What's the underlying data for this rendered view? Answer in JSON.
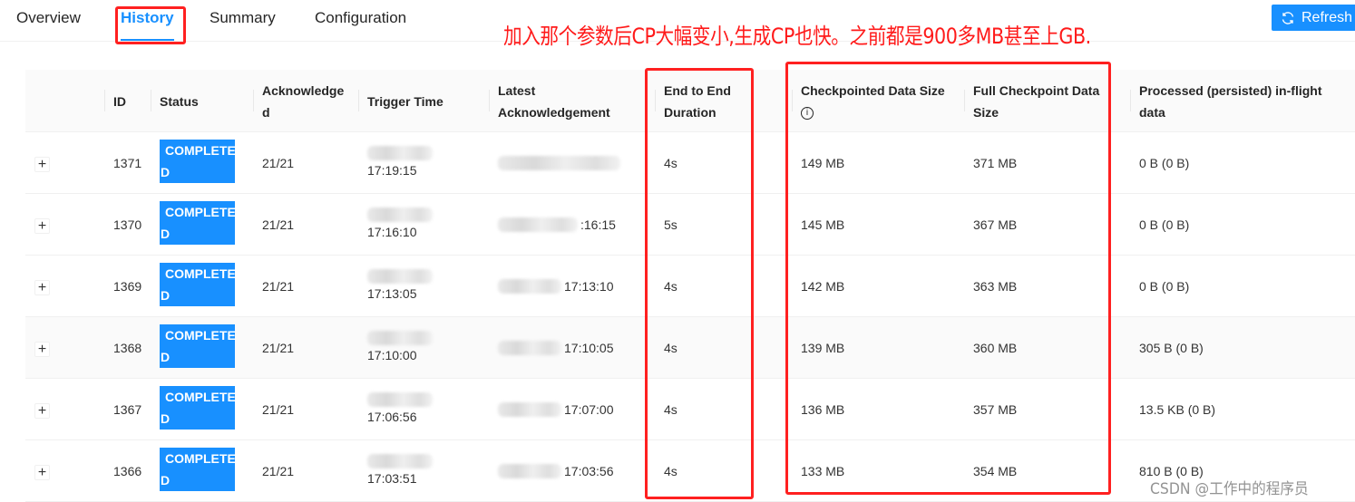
{
  "tabs": [
    {
      "label": "Overview",
      "active": false
    },
    {
      "label": "History",
      "active": true
    },
    {
      "label": "Summary",
      "active": false
    },
    {
      "label": "Configuration",
      "active": false
    }
  ],
  "toolbar": {
    "refresh_label": "Refresh",
    "refresh_icon": "sync-icon"
  },
  "annotation": "加入那个参数后CP大幅变小,生成CP也快。之前都是900多MB甚至上GB.",
  "columns": {
    "id": "ID",
    "status": "Status",
    "acknowledged": "Acknowledged",
    "trigger_time": "Trigger Time",
    "latest_ack": "Latest Acknowledgement",
    "e2e_duration": "End to End Duration",
    "checkpointed_size": "Checkpointed Data Size",
    "full_size": "Full Checkpoint Data Size",
    "inflight": "Processed (persisted) in-flight data"
  },
  "rows": [
    {
      "id": "1371",
      "status": "COMPLETED",
      "acknowledged": "21/21",
      "trigger_time": "17:19:15",
      "latest_ack": "",
      "e2e_duration": "4s",
      "checkpointed_size": "149 MB",
      "full_size": "371 MB",
      "inflight": "0 B (0 B)"
    },
    {
      "id": "1370",
      "status": "COMPLETED",
      "acknowledged": "21/21",
      "trigger_time": "17:16:10",
      "latest_ack": ":16:15",
      "e2e_duration": "5s",
      "checkpointed_size": "145 MB",
      "full_size": "367 MB",
      "inflight": "0 B (0 B)"
    },
    {
      "id": "1369",
      "status": "COMPLETED",
      "acknowledged": "21/21",
      "trigger_time": "17:13:05",
      "latest_ack": "17:13:10",
      "e2e_duration": "4s",
      "checkpointed_size": "142 MB",
      "full_size": "363 MB",
      "inflight": "0 B (0 B)"
    },
    {
      "id": "1368",
      "status": "COMPLETED",
      "acknowledged": "21/21",
      "trigger_time": "17:10:00",
      "latest_ack": "17:10:05",
      "e2e_duration": "4s",
      "checkpointed_size": "139 MB",
      "full_size": "360 MB",
      "inflight": "305 B (0 B)"
    },
    {
      "id": "1367",
      "status": "COMPLETED",
      "acknowledged": "21/21",
      "trigger_time": "17:06:56",
      "latest_ack": "17:07:00",
      "e2e_duration": "4s",
      "checkpointed_size": "136 MB",
      "full_size": "357 MB",
      "inflight": "13.5 KB (0 B)"
    },
    {
      "id": "1366",
      "status": "COMPLETED",
      "acknowledged": "21/21",
      "trigger_time": "17:03:51",
      "latest_ack": "17:03:56",
      "e2e_duration": "4s",
      "checkpointed_size": "133 MB",
      "full_size": "354 MB",
      "inflight": "810 B (0 B)"
    }
  ],
  "watermark": "CSDN @工作中的程序员",
  "colors": {
    "accent": "#1890ff",
    "annotation": "#ff1a1a"
  }
}
